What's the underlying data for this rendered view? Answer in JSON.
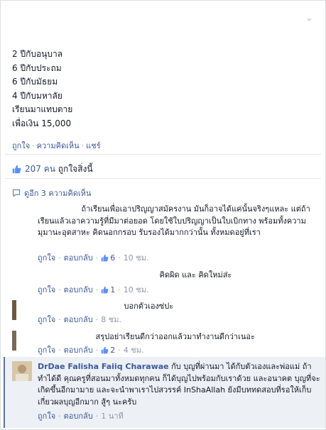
{
  "post": {
    "lines": [
      "2 ปีกับอนุบาล",
      "6 ปีกับประถม",
      "6 ปีกับมัธยม",
      "4 ปีกับมหาลัย",
      "เรียนมาแทบตาย",
      "เพื่อเงิน 15,000"
    ],
    "actions": {
      "like": "ถูกใจ",
      "comment": "ความคิดเห็น",
      "share": "แชร์",
      "sep": "·"
    }
  },
  "likes_summary": {
    "count": "207 คน",
    "text": "ถูกใจสิ่งนี้"
  },
  "view_more": "ดูอีก 3 ความคิดเห็น",
  "comments": [
    {
      "name": "",
      "text": "ถ้าเรียนเพื่อเอาปริญญาสมัครงาน มันก็อาจได้แค่นั้นจริงๆแหละ แต่ถ้าเรียนแล้วเอาความรู้ที่มีมาต่อยอด โดยใช้ใบปริญญาเป็นใบเบิกทาง พร้อมทั้งความมุมานะอุตสาหะ คิดนอกกรอบ รับรองได้มากกว่านั้น ทั้งหมดอยู่ที่เรา",
      "like": "ถูกใจ",
      "reply": "ตอบกลับ",
      "like_count": "6",
      "time": "10 ชม."
    },
    {
      "name": "",
      "text": "คิดผิด และ คิดใหม่ส่ะ",
      "like": "ถูกใจ",
      "reply": "ตอบกลับ",
      "like_count": "1",
      "time": "10 ชม."
    },
    {
      "name": "",
      "text": "บอกตัวเองซ่ปะ",
      "like": "ถูกใจ",
      "reply": "ตอบกลับ",
      "like_count": "",
      "time": "8 ชม."
    },
    {
      "name": "",
      "text": "สรุปอย่าเรียนดีกว่าออกแล้วมาทำงานดีกว่าเนอะ",
      "like": "ถูกใจ",
      "reply": "ตอบกลับ",
      "like_count": "2",
      "time": "4 ชม."
    },
    {
      "name": "DrDae Falisha Faiiq Charawae",
      "text": "กับ บุญที่ผ่านมา ได้กับตัวเองและพ่อแม่ ถ้าทำได้ดี คุณครูที่สอนมาทั้งหมดทุกคน ก็ได้บุญไปพร้อมกับเราด้วย และอนาคต บุญที่จะเกิดขึ้นอีกมามาย และจะนำพาเราไปสวรรค์ InShaAllah ยังมีบททดสอบที่รอให้เก็บเกี่ยวผลบุญอีกมาก สู้ๆ นะครับ",
      "like": "ถูกใจ",
      "reply": "ตอบกลับ",
      "like_count": "",
      "time": "1 นาที"
    }
  ],
  "colors": {
    "link": "#3b5998",
    "meta": "#9197a3",
    "highlight_bg": "#edf0f5"
  }
}
